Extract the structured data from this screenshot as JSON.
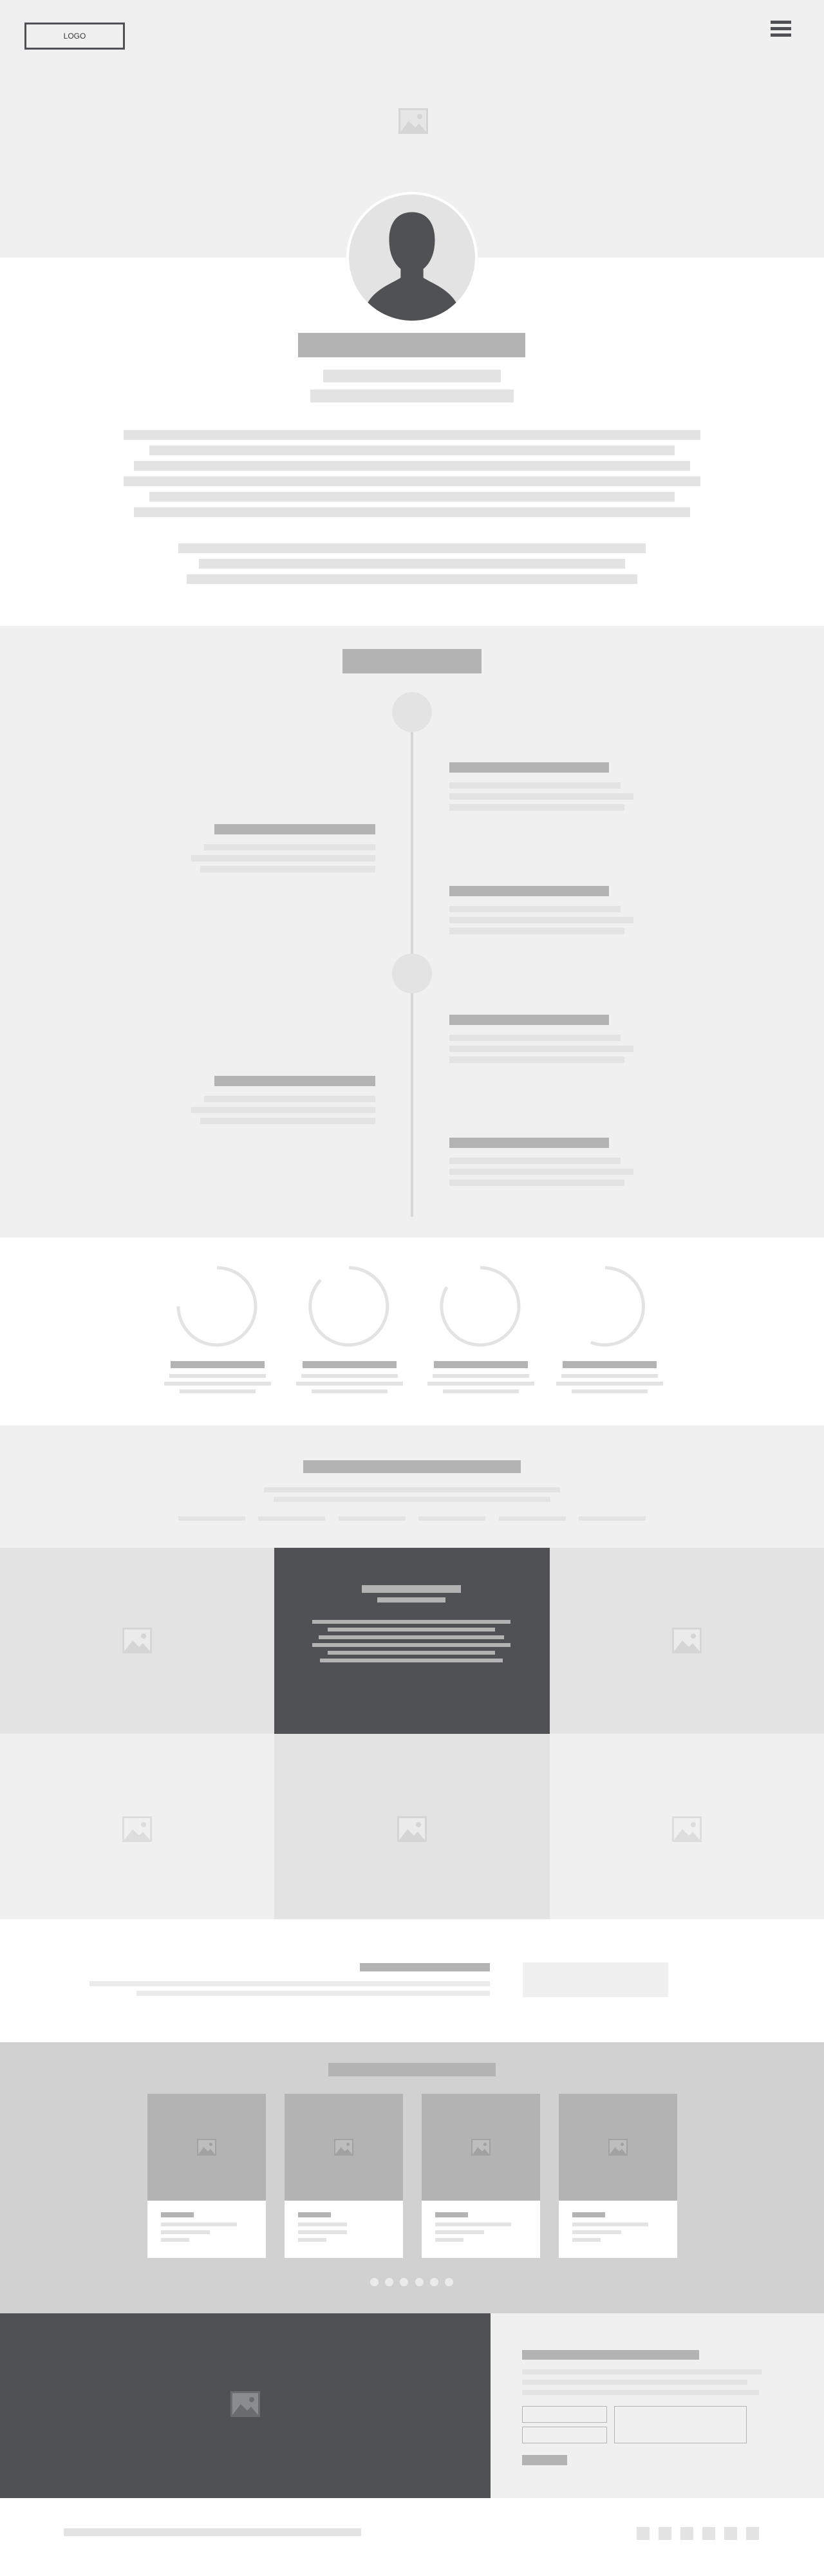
{
  "header": {
    "logo_label": "LOGO",
    "menu_icon": "hamburger-menu-icon"
  },
  "hero": {
    "background_color": "#f0f0f0",
    "image_icon": "image-placeholder-icon",
    "avatar_icon": "user-silhouette-icon"
  },
  "colors": {
    "light_gray": "#f0f0f0",
    "mid_gray": "#e3e3e3",
    "dark_bar": "#b3b3b3",
    "dark_panel": "#4f5154",
    "carousel_bg": "#d1d1d1"
  }
}
